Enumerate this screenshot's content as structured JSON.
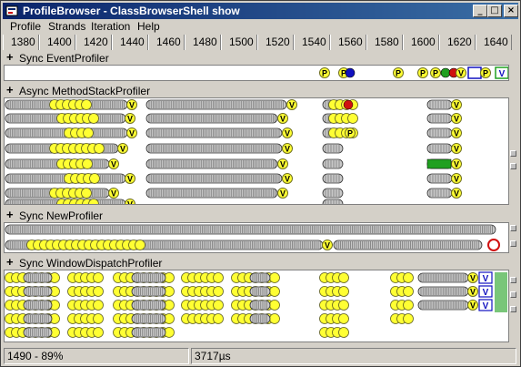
{
  "window": {
    "title": "ProfileBrowser - ClassBrowserShell show"
  },
  "titlebar_buttons": {
    "minimize": "_",
    "maximize": "□",
    "close": "×"
  },
  "menu": [
    "Profile",
    "Strands",
    "Iteration",
    "Help"
  ],
  "ruler": {
    "ticks": [
      "1380",
      "1400",
      "1420",
      "1440",
      "1460",
      "1480",
      "1500",
      "1520",
      "1540",
      "1560",
      "1580",
      "1600",
      "1620",
      "1640"
    ]
  },
  "sections": [
    {
      "label": "Sync EventProfiler",
      "toggle": "+"
    },
    {
      "label": "Async MethodStackProfiler",
      "toggle": "+"
    },
    {
      "label": "Sync NewProfiler",
      "toggle": "+"
    },
    {
      "label": "Sync WindowDispatchProfiler",
      "toggle": "+"
    }
  ],
  "marker_glyphs": {
    "p": "P",
    "v": "V"
  },
  "colors": {
    "marker_fill": "#ffff33",
    "chain_fill": "#c8c8c8",
    "accent_red": "#d01010",
    "accent_green": "#20a020",
    "accent_blue": "#1010c0",
    "bar_dark": "#606060"
  },
  "status": {
    "left": "1490 - 89%",
    "right": "3717µs"
  }
}
